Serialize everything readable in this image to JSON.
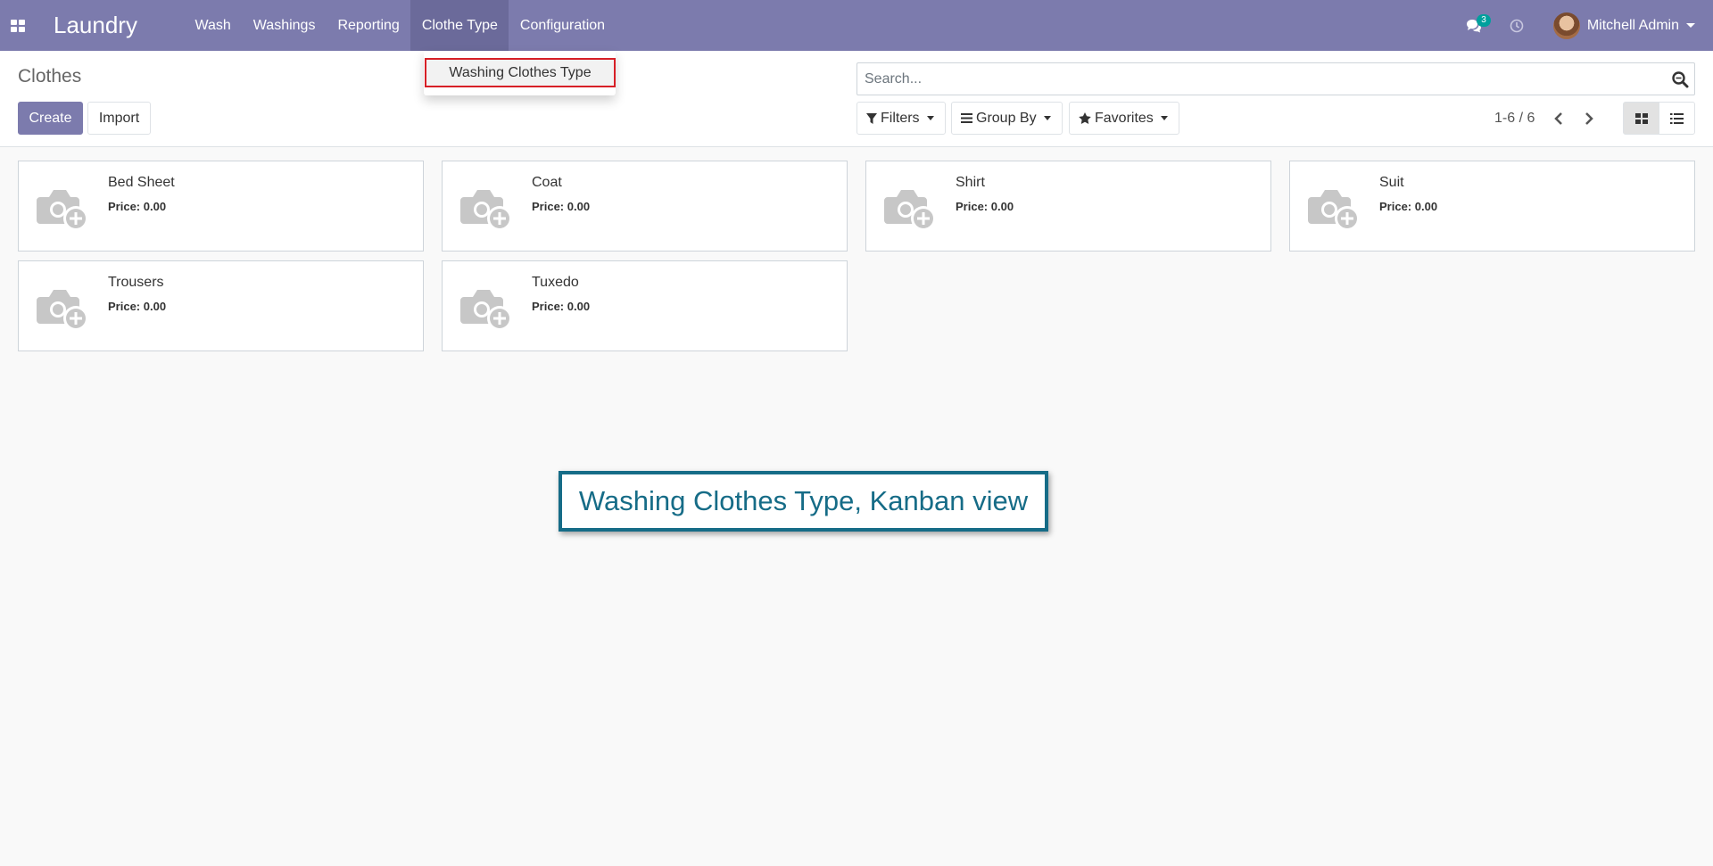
{
  "navbar": {
    "app_name": "Laundry",
    "menu": [
      "Wash",
      "Washings",
      "Reporting",
      "Clothe Type",
      "Configuration"
    ],
    "active_menu_index": 3,
    "chat_count": "3",
    "user_name": "Mitchell Admin",
    "background_color": "#7c7bad"
  },
  "dropdown": {
    "item_label": "Washing Clothes Type"
  },
  "control_panel": {
    "title": "Clothes",
    "create_label": "Create",
    "import_label": "Import",
    "search_placeholder": "Search...",
    "filters_label": "Filters",
    "group_by_label": "Group By",
    "favorites_label": "Favorites",
    "pager": "1-6 / 6",
    "active_view": "kanban"
  },
  "kanban": {
    "price_label": "Price:",
    "records": [
      {
        "name": "Bed Sheet",
        "price": "0.00"
      },
      {
        "name": "Coat",
        "price": "0.00"
      },
      {
        "name": "Shirt",
        "price": "0.00"
      },
      {
        "name": "Suit",
        "price": "0.00"
      },
      {
        "name": "Trousers",
        "price": "0.00"
      },
      {
        "name": "Tuxedo",
        "price": "0.00"
      }
    ]
  },
  "callout": {
    "text": "Washing Clothes Type, Kanban view",
    "color": "#166c87"
  }
}
